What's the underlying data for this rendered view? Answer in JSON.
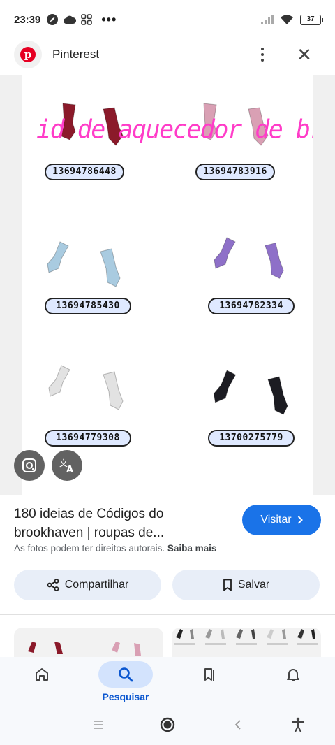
{
  "status_bar": {
    "time": "23:39",
    "battery": "37"
  },
  "header": {
    "site_name": "Pinterest",
    "logo_letter": "p",
    "close_glyph": "✕"
  },
  "image": {
    "overlay_title": "id de aquecedor de braço",
    "codes": [
      "13694786448",
      "13694783916",
      "13694785430",
      "13694782334",
      "13694779308",
      "13700275779"
    ],
    "sock_colors": [
      "#8b1a2a",
      "#d9a0b4",
      "#a9cbe0",
      "#8e70c8",
      "#e2e2e2",
      "#1c1c22"
    ],
    "lens_icon": "google-lens-icon",
    "translate_icon": "translate-icon"
  },
  "result": {
    "title": "180 ideias de Códigos do brookhaven | roupas de...",
    "visit_label": "Visitar",
    "copyright_text": "As fotos podem ter direitos autorais.",
    "learn_more": "Saiba mais",
    "share_label": "Compartilhar",
    "save_label": "Salvar"
  },
  "bottom_nav": {
    "active_label": "Pesquisar",
    "items": [
      "home-icon",
      "search-icon",
      "collections-icon",
      "notifications-icon"
    ]
  },
  "colors": {
    "accent": "#1a73e8",
    "active_nav_bg": "#d3e3fd",
    "overlay_text": "#ff3cc8"
  }
}
